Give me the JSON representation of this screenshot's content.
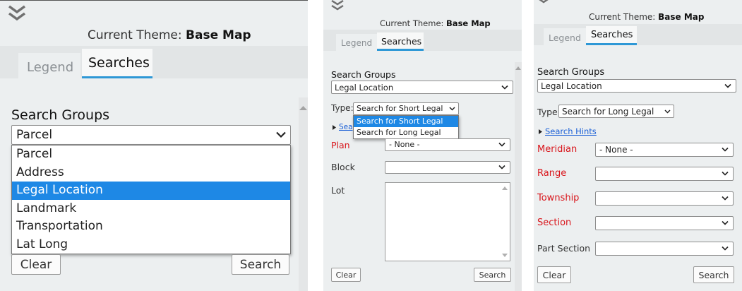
{
  "theme": {
    "prefix": "Current Theme:",
    "name": "Base Map"
  },
  "tabs": {
    "legend": "Legend",
    "searches": "Searches"
  },
  "search_groups_label": "Search Groups",
  "colors": {
    "accent": "#2e98d6",
    "required": "#d9161c",
    "selection": "#1e88e5",
    "link": "#1a5fd6"
  },
  "panel1": {
    "selected_group": "Parcel",
    "group_options": [
      "Parcel",
      "Address",
      "Legal Location",
      "Landmark",
      "Transportation",
      "Lat Long"
    ],
    "highlighted_option": "Legal Location",
    "clear": "Clear",
    "search": "Search"
  },
  "panel2": {
    "selected_group": "Legal Location",
    "type_label": "Type:",
    "type_value": "Search for Short Legal",
    "type_options": [
      "Search for Short Legal",
      "Search for Long Legal"
    ],
    "hints_partial": "Sea",
    "fields": [
      {
        "label": "Plan",
        "value": "- None -"
      },
      {
        "label": "Block",
        "value": ""
      },
      {
        "label": "Lot",
        "value": ""
      }
    ],
    "clear": "Clear",
    "search": "Search"
  },
  "panel3": {
    "selected_group": "Legal Location",
    "type_label": "Type:",
    "type_value": "Search for Long Legal",
    "hints": "Search Hints",
    "fields": [
      {
        "label": "Meridian",
        "value": "- None -"
      },
      {
        "label": "Range",
        "value": ""
      },
      {
        "label": "Township",
        "value": ""
      },
      {
        "label": "Section",
        "value": ""
      },
      {
        "label": "Part Section",
        "value": ""
      }
    ],
    "clear": "Clear",
    "search": "Search"
  }
}
